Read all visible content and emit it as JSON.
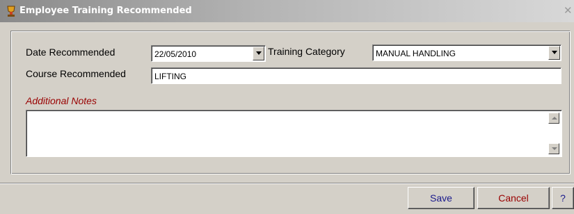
{
  "window": {
    "title": "Employee Training Recommended",
    "close_glyph": "✕"
  },
  "form": {
    "date_label": "Date Recommended",
    "date_value": "22/05/2010",
    "category_label": "Training Category",
    "category_value": "MANUAL HANDLING",
    "course_label": "Course Recommended",
    "course_value": "LIFTING",
    "notes_label": "Additional Notes",
    "notes_value": ""
  },
  "buttons": {
    "save": "Save",
    "cancel": "Cancel",
    "help": "?"
  },
  "colors": {
    "notes_label": "#990000",
    "button_text": "#1a1a8c",
    "cancel_text": "#990000"
  }
}
